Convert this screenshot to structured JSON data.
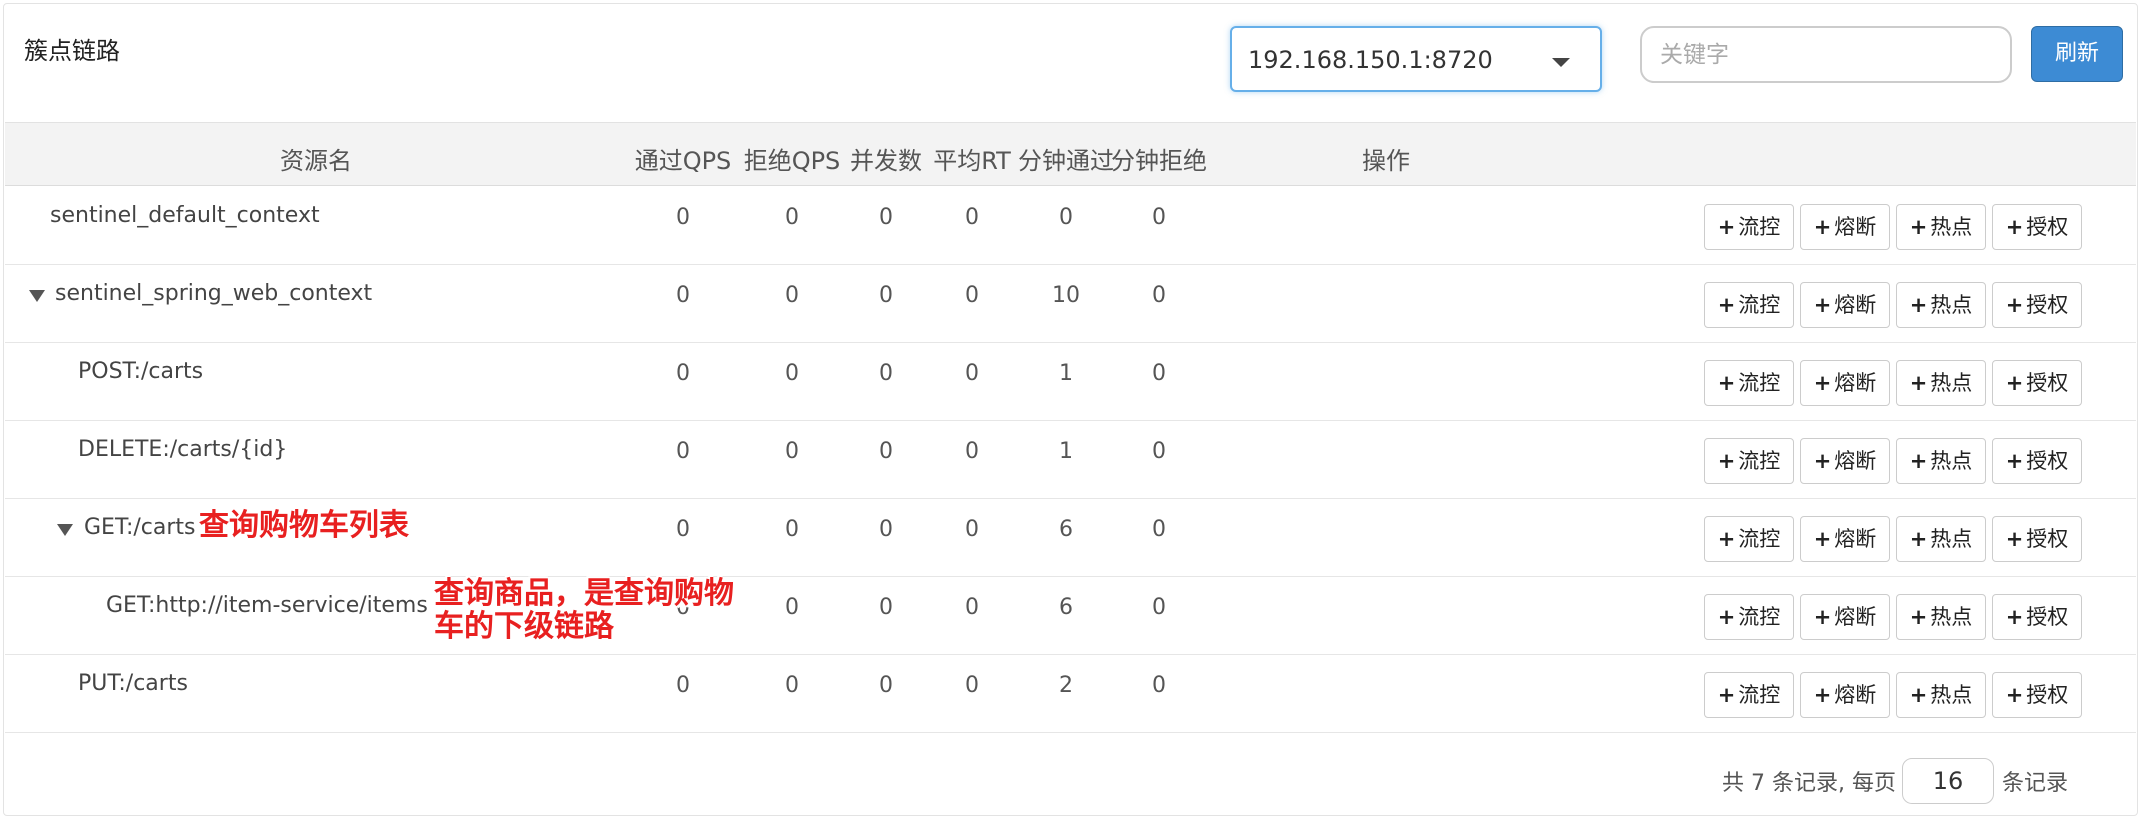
{
  "header": {
    "title": "簇点链路",
    "machine": "192.168.150.1:8720",
    "search_placeholder": "关键字",
    "refresh": "刷新"
  },
  "columns": [
    "资源名",
    "通过QPS",
    "拒绝QPS",
    "并发数",
    "平均RT",
    "分钟通过",
    "分钟拒绝",
    "操作"
  ],
  "rows": [
    {
      "name": "sentinel_default_context",
      "pass_qps": "0",
      "block_qps": "0",
      "threads": "0",
      "avg_rt": "0",
      "min_pass": "0",
      "min_block": "0"
    },
    {
      "name": "sentinel_spring_web_context",
      "pass_qps": "0",
      "block_qps": "0",
      "threads": "0",
      "avg_rt": "0",
      "min_pass": "10",
      "min_block": "0"
    },
    {
      "name": "POST:/carts",
      "pass_qps": "0",
      "block_qps": "0",
      "threads": "0",
      "avg_rt": "0",
      "min_pass": "1",
      "min_block": "0"
    },
    {
      "name": "DELETE:/carts/{id}",
      "pass_qps": "0",
      "block_qps": "0",
      "threads": "0",
      "avg_rt": "0",
      "min_pass": "1",
      "min_block": "0"
    },
    {
      "name": "GET:/carts",
      "pass_qps": "0",
      "block_qps": "0",
      "threads": "0",
      "avg_rt": "0",
      "min_pass": "6",
      "min_block": "0"
    },
    {
      "name": "GET:http://item-service/items",
      "pass_qps": "0",
      "block_qps": "0",
      "threads": "0",
      "avg_rt": "0",
      "min_pass": "6",
      "min_block": "0"
    },
    {
      "name": "PUT:/carts",
      "pass_qps": "0",
      "block_qps": "0",
      "threads": "0",
      "avg_rt": "0",
      "min_pass": "2",
      "min_block": "0"
    }
  ],
  "actions": {
    "flow": "流控",
    "degrade": "熔断",
    "hotspot": "热点",
    "auth": "授权"
  },
  "annotations": {
    "get_carts": "查询购物车列表",
    "items_line1": "查询商品，是查询购物",
    "items_line2": "车的下级链路"
  },
  "pagination": {
    "total_text": "共 7 条记录, 每页",
    "page_size": "16",
    "suffix": "条记录"
  },
  "colors": {
    "primary": "#3d8bd4",
    "annotation": "#e82020",
    "header_bg": "#f3f3f3"
  }
}
